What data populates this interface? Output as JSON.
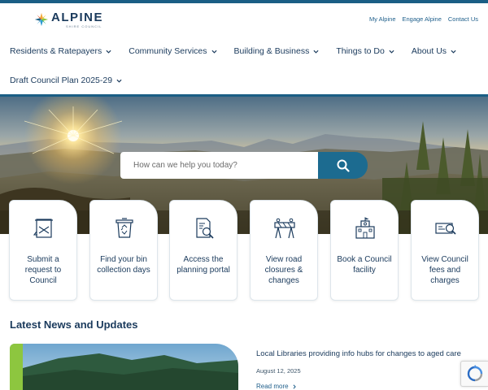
{
  "brand": {
    "name": "ALPINE",
    "sub": "SHIRE COUNCIL",
    "accent": "#1a5e85"
  },
  "utility_links": [
    "My Alpine",
    "Engage Alpine",
    "Contact Us"
  ],
  "nav": {
    "items": [
      "Residents & Ratepayers",
      "Community Services",
      "Building & Business",
      "Things to Do",
      "About Us",
      "Draft Council Plan 2025-29"
    ]
  },
  "search": {
    "placeholder": "How can we help you today?",
    "button_icon": "search-icon"
  },
  "quick_links": [
    {
      "label": "Submit a request to Council",
      "icon": "request-icon"
    },
    {
      "label": "Find your bin collection days",
      "icon": "recycle-bin-icon"
    },
    {
      "label": "Access the planning portal",
      "icon": "planning-document-icon"
    },
    {
      "label": "View road closures & changes",
      "icon": "road-barrier-icon"
    },
    {
      "label": "Book a Council facility",
      "icon": "building-icon"
    },
    {
      "label": "View Council fees and charges",
      "icon": "fees-card-icon"
    }
  ],
  "news": {
    "heading": "Latest News and Updates",
    "items": [
      {
        "title": "Local Libraries providing info hubs for changes to aged care",
        "date": "August 12, 2025",
        "link": "Read more"
      }
    ]
  },
  "colors": {
    "text": "#1a3a5c",
    "link": "#1f5f8b",
    "search_button": "#1c6b90",
    "news_accent": "#8dc63f"
  }
}
